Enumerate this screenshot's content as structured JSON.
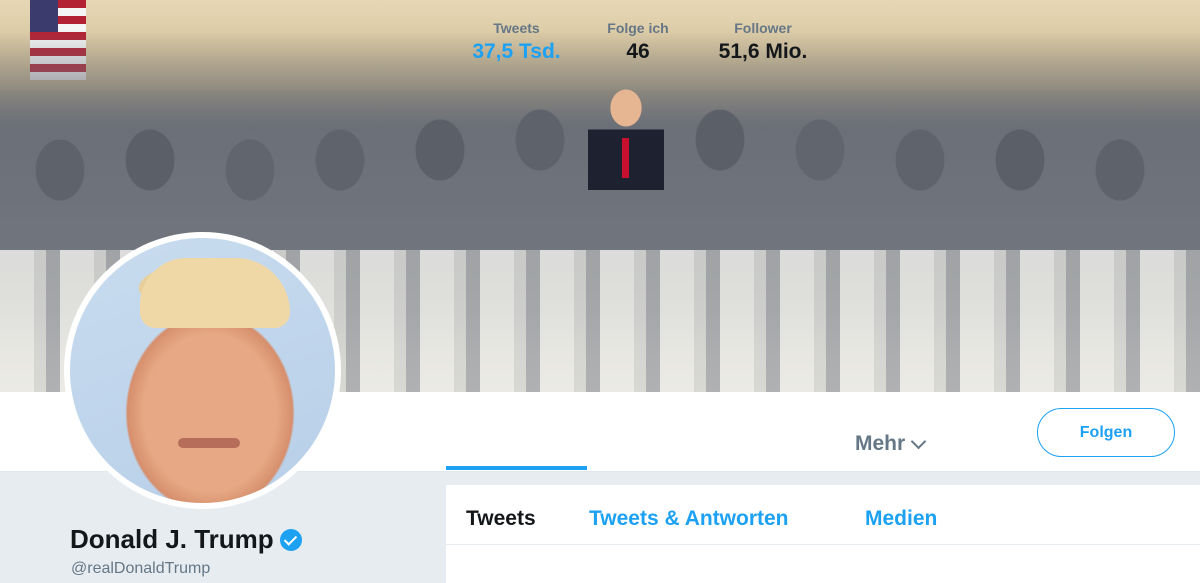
{
  "header": {
    "photo_alt": "Header photo"
  },
  "stats": [
    {
      "label": "Tweets",
      "value": "37,5 Tsd.",
      "active": true
    },
    {
      "label": "Folge ich",
      "value": "46",
      "active": false
    },
    {
      "label": "Follower",
      "value": "51,6 Mio.",
      "active": false
    }
  ],
  "more_label": "Mehr",
  "follow_label": "Folgen",
  "profile": {
    "name": "Donald J. Trump",
    "handle": "@realDonaldTrump"
  },
  "timeline_tabs": [
    {
      "label": "Tweets",
      "active": true
    },
    {
      "label": "Tweets & Antworten",
      "active": false
    },
    {
      "label": "Medien",
      "active": false
    }
  ],
  "colors": {
    "accent": "#1da1f2",
    "muted": "#657786",
    "text": "#14171a",
    "background": "#e6ecf0"
  }
}
